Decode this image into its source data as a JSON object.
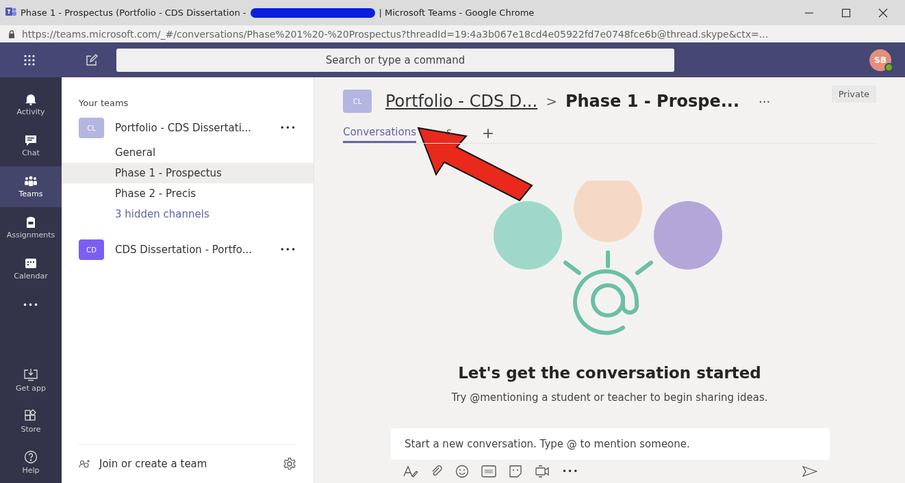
{
  "window": {
    "title_start": "Phase 1 - Prospectus (Portfolio - CDS Dissertation -",
    "title_end": "| Microsoft Teams - Google Chrome",
    "url": "https://teams.microsoft.com/_#/conversations/Phase%201%20-%20Prospectus?threadId=19:4a3b067e18cd4e05922fd7e0748fce6b@thread.skype&ctx=..."
  },
  "topbar": {
    "search_placeholder": "Search or type a command",
    "avatar": "SB"
  },
  "rail": {
    "items": [
      {
        "label": "Activity",
        "kind": "activity",
        "selected": false
      },
      {
        "label": "Chat",
        "kind": "chat",
        "selected": false
      },
      {
        "label": "Teams",
        "kind": "teams",
        "selected": true
      },
      {
        "label": "Assignments",
        "kind": "assignments",
        "selected": false
      },
      {
        "label": "Calendar",
        "kind": "calendar",
        "selected": false
      }
    ],
    "more": "•••",
    "bottom_items": [
      {
        "label": "Get app",
        "kind": "getapp"
      },
      {
        "label": "Store",
        "kind": "store"
      },
      {
        "label": "Help",
        "kind": "help"
      }
    ]
  },
  "teams_panel": {
    "heading": "Your teams",
    "teams": [
      {
        "initials": "CL",
        "name": "Portfolio - CDS Dissertati...",
        "color": "#b4b5e0",
        "more": "•••",
        "channels": [
          {
            "label": "General",
            "kind": "channel",
            "selected": false
          },
          {
            "label": "Phase 1 - Prospectus",
            "kind": "channel",
            "selected": true
          },
          {
            "label": "Phase 2 - Precis",
            "kind": "channel",
            "selected": false
          },
          {
            "label": "3 hidden channels",
            "kind": "link",
            "selected": false
          }
        ]
      },
      {
        "initials": "CD",
        "name": "CDS Dissertation - Portfo...",
        "color": "#7b5ff0",
        "more": "•••"
      }
    ],
    "join": "Join or create a team"
  },
  "header": {
    "initials": "CL",
    "team": "Portfolio - CDS D...",
    "separator": ">",
    "channel": "Phase 1 - Prospe...",
    "more": "···",
    "badge": "Private",
    "tabs": [
      {
        "label": "Conversations",
        "selected": true
      },
      {
        "label": "s",
        "selected": false
      }
    ],
    "add": "+"
  },
  "empty_state": {
    "title": "Let's get the conversation started",
    "subtitle": "Try @mentioning a student or teacher to begin sharing ideas."
  },
  "compose": {
    "placeholder": "Start a new conversation. Type @ to mention someone.",
    "more": "•••"
  }
}
